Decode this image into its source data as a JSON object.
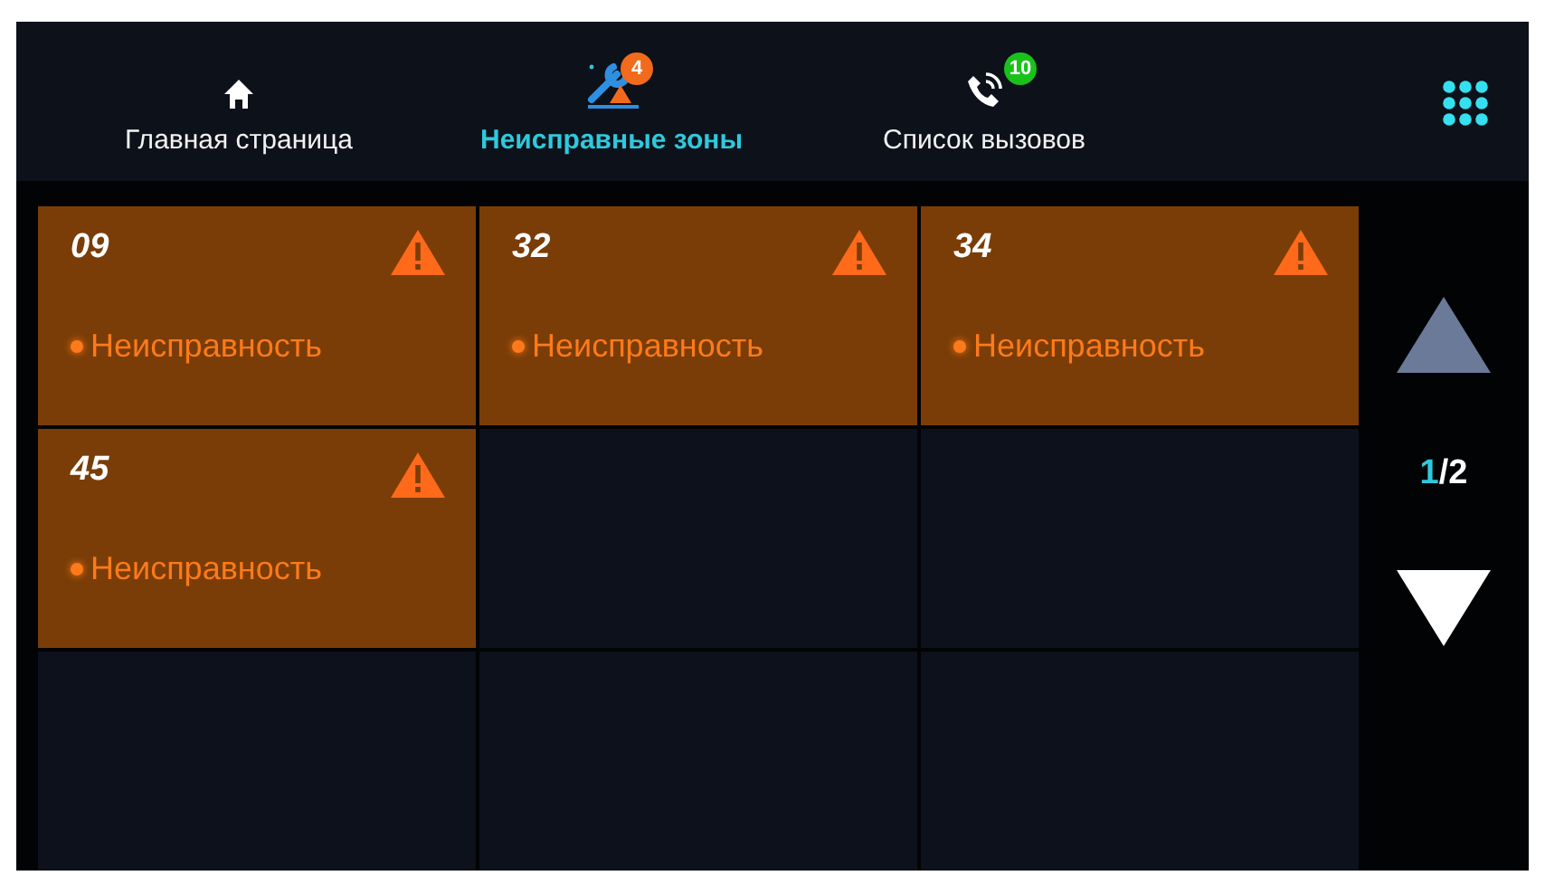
{
  "tabs": [
    {
      "label": "Главная страница",
      "kind": "home",
      "selected": false
    },
    {
      "label": "Неисправные зоны",
      "kind": "faults",
      "badge": "4",
      "color": "#f26a1b",
      "selected": true
    },
    {
      "label": "Список вызовов",
      "kind": "calls",
      "badge": "10",
      "color": "#19c21a",
      "selected": false
    }
  ],
  "zones": [
    {
      "kind": "zone",
      "number": "09",
      "status": "Неисправность"
    },
    {
      "kind": "zone",
      "number": "32",
      "status": "Неисправность"
    },
    {
      "kind": "zone",
      "number": "34",
      "status": "Неисправность"
    },
    {
      "kind": "zone",
      "number": "45",
      "status": "Неисправность"
    },
    {
      "kind": "empty"
    },
    {
      "kind": "empty"
    },
    {
      "kind": "empty"
    },
    {
      "kind": "empty"
    },
    {
      "kind": "empty"
    }
  ],
  "pager": {
    "up_disabled": true,
    "down_disabled": false,
    "current": "1",
    "rest": "/2"
  }
}
